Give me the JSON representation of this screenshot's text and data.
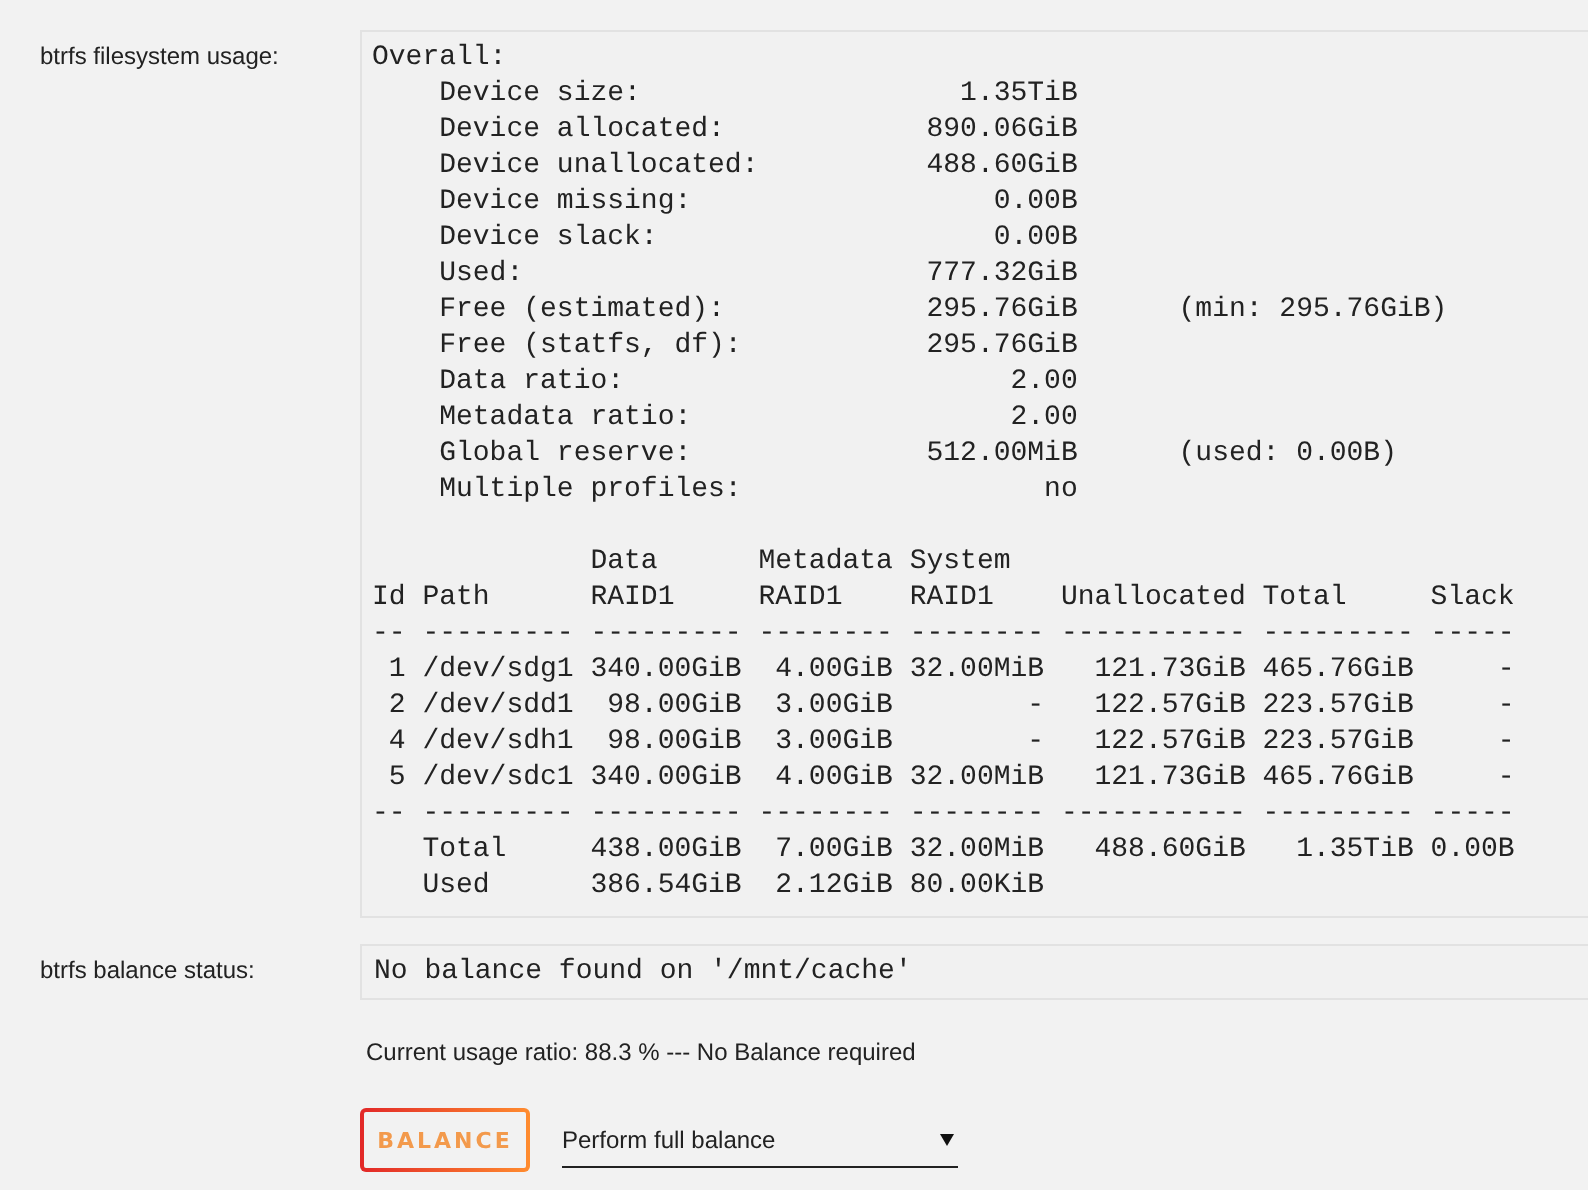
{
  "usage": {
    "label": "btrfs filesystem usage:",
    "overall_lines": [
      "Overall:",
      "    Device size:                   1.35TiB",
      "    Device allocated:            890.06GiB",
      "    Device unallocated:          488.60GiB",
      "    Device missing:                  0.00B",
      "    Device slack:                    0.00B",
      "    Used:                        777.32GiB",
      "    Free (estimated):            295.76GiB      (min: 295.76GiB)",
      "    Free (statfs, df):           295.76GiB",
      "    Data ratio:                       2.00",
      "    Metadata ratio:                   2.00",
      "    Global reserve:              512.00MiB      (used: 0.00B)",
      "    Multiple profiles:                  no"
    ],
    "table_lines": [
      "             Data      Metadata System",
      "Id Path      RAID1     RAID1    RAID1    Unallocated Total     Slack",
      "-- --------- --------- -------- -------- ----------- --------- -----",
      " 1 /dev/sdg1 340.00GiB  4.00GiB 32.00MiB   121.73GiB 465.76GiB     -",
      " 2 /dev/sdd1  98.00GiB  3.00GiB        -   122.57GiB 223.57GiB     -",
      " 4 /dev/sdh1  98.00GiB  3.00GiB        -   122.57GiB 223.57GiB     -",
      " 5 /dev/sdc1 340.00GiB  4.00GiB 32.00MiB   121.73GiB 465.76GiB     -",
      "-- --------- --------- -------- -------- ----------- --------- -----",
      "   Total     438.00GiB  7.00GiB 32.00MiB   488.60GiB   1.35TiB 0.00B",
      "   Used      386.54GiB  2.12GiB 80.00KiB"
    ]
  },
  "balance": {
    "label": "btrfs balance status:",
    "output": "No balance found on '/mnt/cache'",
    "note": "Current usage ratio: 88.3 % --- No Balance required",
    "button": "BALANCE",
    "select": {
      "value": "Perform full balance"
    }
  }
}
